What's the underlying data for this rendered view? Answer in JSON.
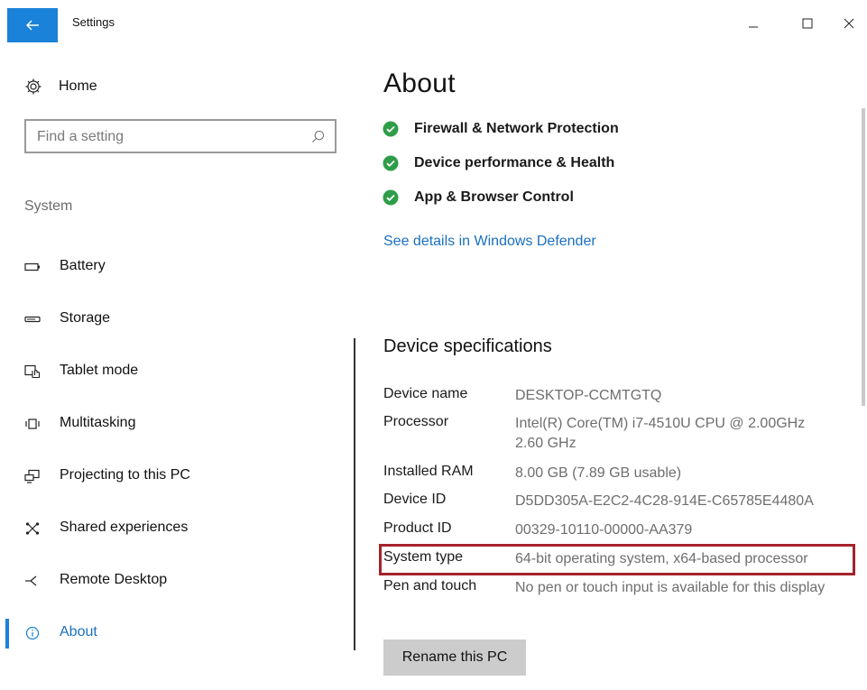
{
  "window": {
    "title": "Settings",
    "accent_color": "#1a82d9"
  },
  "sidebar": {
    "home_label": "Home",
    "search": {
      "placeholder": "Find a setting",
      "value": ""
    },
    "section_label": "System",
    "items": [
      {
        "label": "Battery",
        "icon": "battery-icon",
        "active": false
      },
      {
        "label": "Storage",
        "icon": "storage-icon",
        "active": false
      },
      {
        "label": "Tablet mode",
        "icon": "tablet-mode-icon",
        "active": false
      },
      {
        "label": "Multitasking",
        "icon": "multitasking-icon",
        "active": false
      },
      {
        "label": "Projecting to this PC",
        "icon": "projecting-icon",
        "active": false
      },
      {
        "label": "Shared experiences",
        "icon": "shared-experiences-icon",
        "active": false
      },
      {
        "label": "Remote Desktop",
        "icon": "remote-desktop-icon",
        "active": false
      },
      {
        "label": "About",
        "icon": "info-icon",
        "active": true
      }
    ]
  },
  "main": {
    "title": "About",
    "status_color": "#2e9d48",
    "status_items": [
      {
        "label": "Firewall & Network Protection",
        "icon": "check-circle-icon"
      },
      {
        "label": "Device performance & Health",
        "icon": "check-circle-icon"
      },
      {
        "label": "App & Browser Control",
        "icon": "check-circle-icon"
      }
    ],
    "defender_link": "See details in Windows Defender",
    "specs_title": "Device specifications",
    "specs": [
      {
        "key": "Device name",
        "value": "DESKTOP-CCMTGTQ"
      },
      {
        "key": "Processor",
        "value": "Intel(R) Core(TM) i7-4510U CPU @ 2.00GHz 2.60 GHz"
      },
      {
        "key": "Installed RAM",
        "value": "8.00 GB (7.89 GB usable)"
      },
      {
        "key": "Device ID",
        "value": "D5DD305A-E2C2-4C28-914E-C65785E4480A"
      },
      {
        "key": "Product ID",
        "value": "00329-10110-00000-AA379"
      },
      {
        "key": "System type",
        "value": "64-bit operating system, x64-based processor",
        "highlighted": true
      },
      {
        "key": "Pen and touch",
        "value": "No pen or touch input is available for this display"
      }
    ],
    "highlight_color": "#a4232a",
    "rename_button": "Rename this PC"
  }
}
